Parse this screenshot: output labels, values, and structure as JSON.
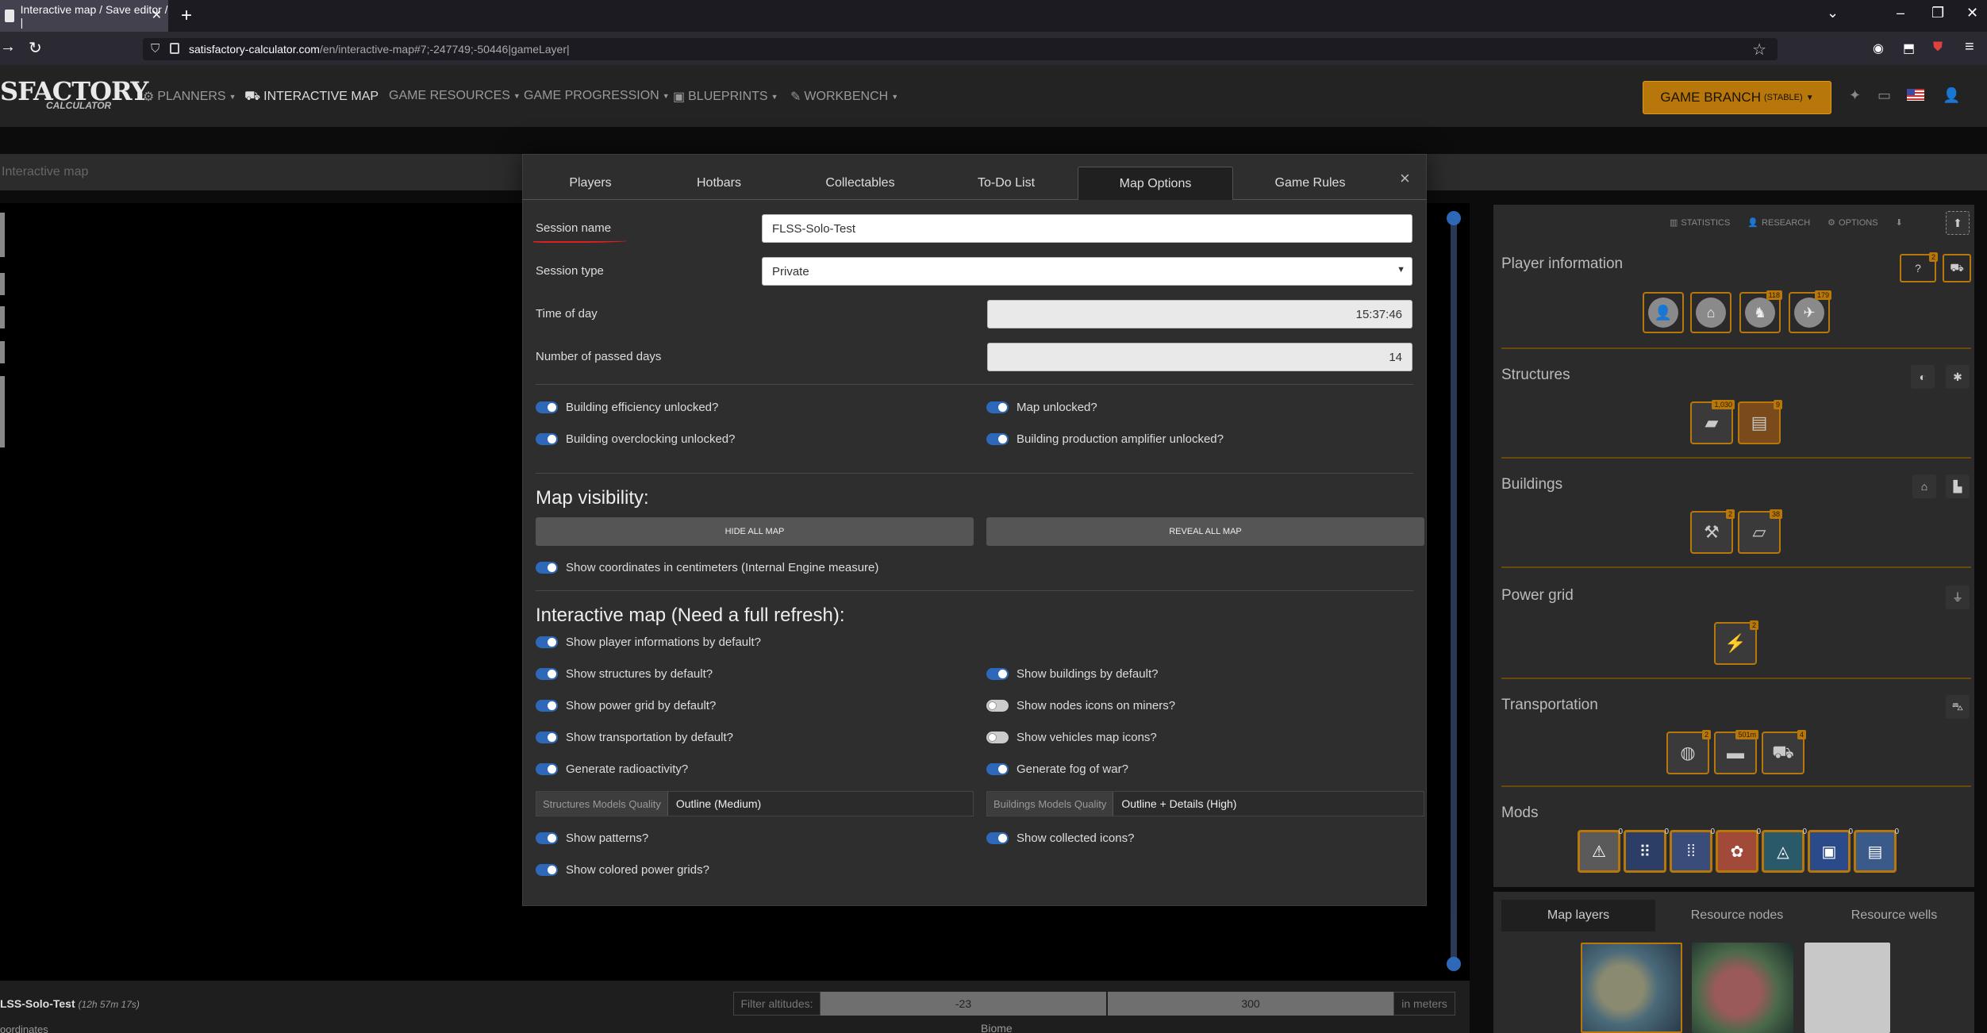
{
  "browser": {
    "tab_title": "Interactive map / Save editor / |",
    "tab_close": "✕",
    "new_tab": "+",
    "url_domain": "satisfactory-calculator.com",
    "url_path": "/en/interactive-map#7;-247749;-50446|gameLayer|"
  },
  "site": {
    "logo_text": "SFACTORY",
    "logo_sub": "CALCULATOR",
    "menu": [
      {
        "label": "PLANNERS"
      },
      {
        "label": "INTERACTIVE MAP"
      },
      {
        "label": "GAME RESOURCES"
      },
      {
        "label": "GAME PROGRESSION"
      },
      {
        "label": "BLUEPRINTS"
      },
      {
        "label": "WORKBENCH"
      }
    ],
    "branch_label": "GAME BRANCH",
    "branch_sub": "(STABLE)"
  },
  "breadcrumb": "Interactive map",
  "status": {
    "session_name": "LSS-Solo-Test",
    "session_time": "(12h 57m 17s)",
    "coords_label": "oordinates",
    "filter_label": "Filter altitudes:",
    "alt_min": "-23",
    "alt_max": "300",
    "alt_unit": "in meters",
    "biome_label": "Biome"
  },
  "sidebar": {
    "toolbar": {
      "statistics": "STATISTICS",
      "research": "RESEARCH",
      "options": "OPTIONS"
    },
    "sections": {
      "player_info": "Player information",
      "structures": "Structures",
      "buildings": "Buildings",
      "power_grid": "Power grid",
      "transportation": "Transportation",
      "mods": "Mods"
    },
    "player_badges": {
      "b3": "118",
      "b4": "179"
    },
    "help_badge": "2",
    "structure_badges": [
      "1,030",
      "9"
    ],
    "building_badges": [
      "2",
      "38"
    ],
    "power_badge": "2",
    "transport_badges": [
      "2",
      "501m",
      "4"
    ],
    "mod_badges": [
      "0",
      "0",
      "0",
      "0",
      "0",
      "0",
      "0"
    ],
    "layer_tabs": [
      "Map layers",
      "Resource nodes",
      "Resource wells"
    ]
  },
  "modal": {
    "tabs": [
      "Players",
      "Hotbars",
      "Collectables",
      "To-Do List",
      "Map Options",
      "Game Rules"
    ],
    "close": "×",
    "session_name_label": "Session name",
    "session_name_value": "FLSS-Solo-Test",
    "session_type_label": "Session type",
    "session_type_value": "Private",
    "time_of_day_label": "Time of day",
    "time_of_day_value": "15:37:46",
    "passed_days_label": "Number of passed days",
    "passed_days_value": "14",
    "unlock_toggles": [
      "Building efficiency unlocked?",
      "Map unlocked?",
      "Building overclocking unlocked?",
      "Building production amplifier unlocked?"
    ],
    "map_visibility_heading": "Map visibility:",
    "hide_all_map": "HIDE ALL MAP",
    "reveal_all_map": "REVEAL ALL MAP",
    "coords_toggle": "Show coordinates in centimeters (Internal Engine measure)",
    "interactive_heading": "Interactive map (Need a full refresh):",
    "im_toggles": {
      "player_info": "Show player informations by default?",
      "structures": "Show structures by default?",
      "buildings": "Show buildings by default?",
      "power_grid": "Show power grid by default?",
      "nodes_miners": "Show nodes icons on miners?",
      "transportation": "Show transportation by default?",
      "vehicles": "Show vehicles map icons?",
      "radioactivity": "Generate radioactivity?",
      "fog": "Generate fog of war?",
      "patterns": "Show patterns?",
      "collected": "Show collected icons?",
      "colored_grids": "Show colored power grids?"
    },
    "structures_quality_label": "Structures Models Quality",
    "structures_quality_value": "Outline (Medium)",
    "buildings_quality_label": "Buildings Models Quality",
    "buildings_quality_value": "Outline + Details (High)"
  }
}
